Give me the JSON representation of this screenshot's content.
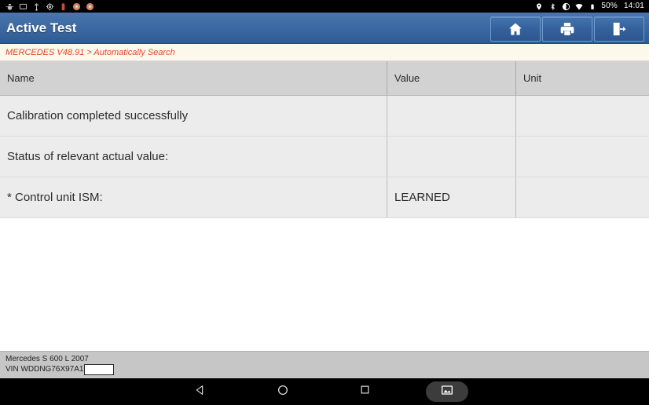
{
  "status_bar": {
    "left_icons": [
      "android-debug-icon",
      "screenshot-icon",
      "usb-icon",
      "settings-gear-icon",
      "battery-alert-icon",
      "app-browser-icon",
      "app-chrome-icon"
    ],
    "right_icons": [
      "location-pin-icon",
      "bluetooth-icon",
      "auto-rotate-icon",
      "wifi-icon",
      "battery-icon"
    ],
    "battery_percent": "50%",
    "clock": "14:01"
  },
  "header": {
    "title": "Active Test",
    "buttons": [
      {
        "name": "home-button",
        "icon": "home-icon"
      },
      {
        "name": "print-button",
        "icon": "printer-icon"
      },
      {
        "name": "exit-button",
        "icon": "exit-icon"
      }
    ]
  },
  "breadcrumb": {
    "text": "MERCEDES V48.91 > Automatically Search",
    "color": "#e04a28"
  },
  "table": {
    "columns": [
      "Name",
      "Value",
      "Unit"
    ],
    "rows": [
      {
        "name": "Calibration completed successfully",
        "value": "",
        "unit": ""
      },
      {
        "name": "Status of relevant actual value:",
        "value": "",
        "unit": ""
      },
      {
        "name": "* Control unit ISM:",
        "value": "LEARNED",
        "unit": ""
      }
    ]
  },
  "footer": {
    "vehicle": "Mercedes S 600 L 2007",
    "vin_label": "VIN WDDNG76X97A1",
    "vin_redacted": ""
  },
  "nav_bar": {
    "back": "back-icon",
    "home": "home-circle-icon",
    "recents": "recents-square-icon",
    "screenshot": "screenshot-image-icon"
  }
}
